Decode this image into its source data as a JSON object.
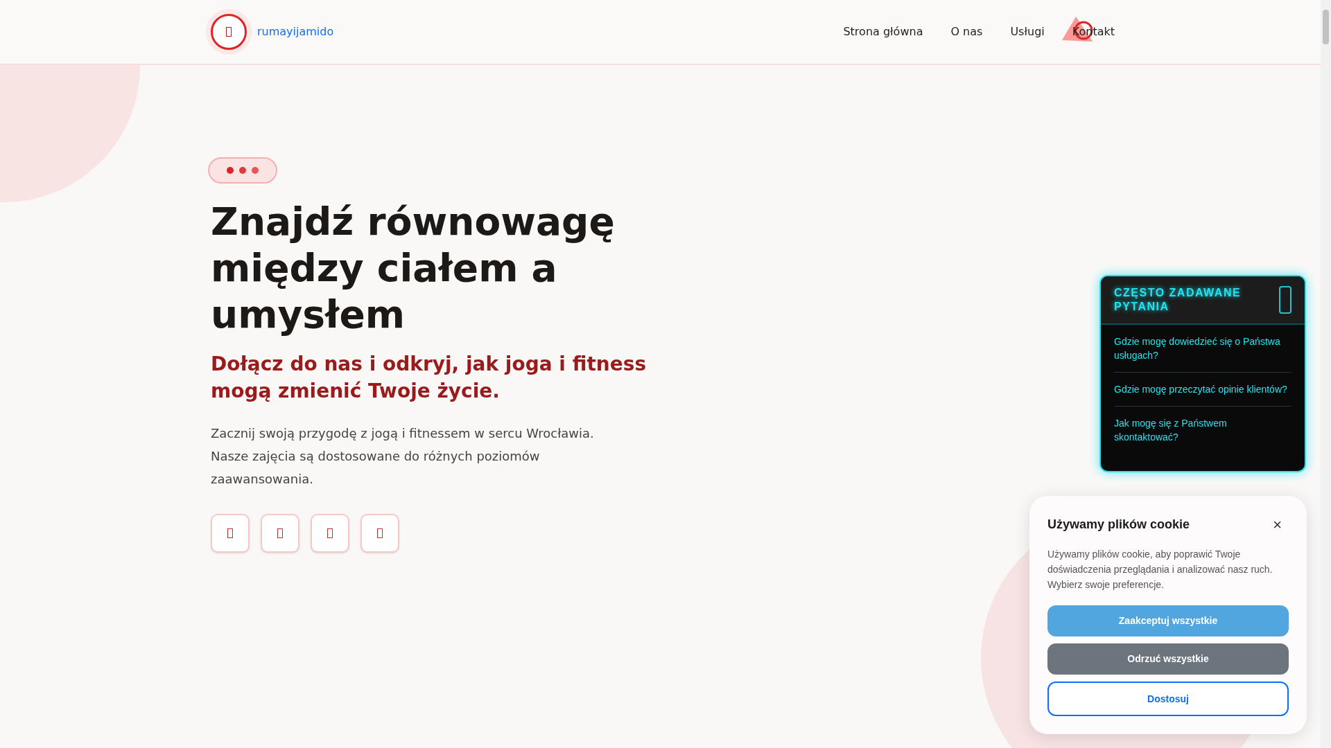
{
  "header": {
    "brand": "rumayijamido",
    "nav": [
      {
        "label": "Strona główna"
      },
      {
        "label": "O nas"
      },
      {
        "label": "Usługi"
      },
      {
        "label": "Kontakt"
      }
    ]
  },
  "hero": {
    "title": "Znajdź równowagę między ciałem a umysłem",
    "subtitle": "Dołącz do nas i odkryj, jak joga i fitness mogą zmienić Twoje życie.",
    "text": "Zacznij swoją przygodę z jogą i fitnessem w sercu Wrocławia. Nasze zajęcia są dostosowane do różnych poziomów zaawansowania.",
    "social_buttons": [
      {
        "kind": "icon"
      },
      {
        "kind": "icon"
      },
      {
        "kind": "icon"
      },
      {
        "kind": "icon"
      }
    ]
  },
  "faq": {
    "title": "CZĘSTO ZADAWANE PYTANIA",
    "questions": [
      "Gdzie mogę dowiedzieć się o Państwa usługach?",
      "Gdzie mogę przeczytać opinie klientów?",
      "Jak mogę się z Państwem skontaktować?"
    ]
  },
  "cookie": {
    "title": "Używamy plików cookie",
    "close": "×",
    "text": "Używamy plików cookie, aby poprawić Twoje doświadczenia przeglądania i analizować nasz ruch. Wybierz swoje preferencje.",
    "buttons": [
      {
        "label": "Zaakceptuj wszystkie",
        "kind": "primary"
      },
      {
        "label": "Odrzuć wszystkie",
        "kind": "secondary"
      },
      {
        "label": "Dostosuj",
        "kind": "outline"
      }
    ]
  }
}
